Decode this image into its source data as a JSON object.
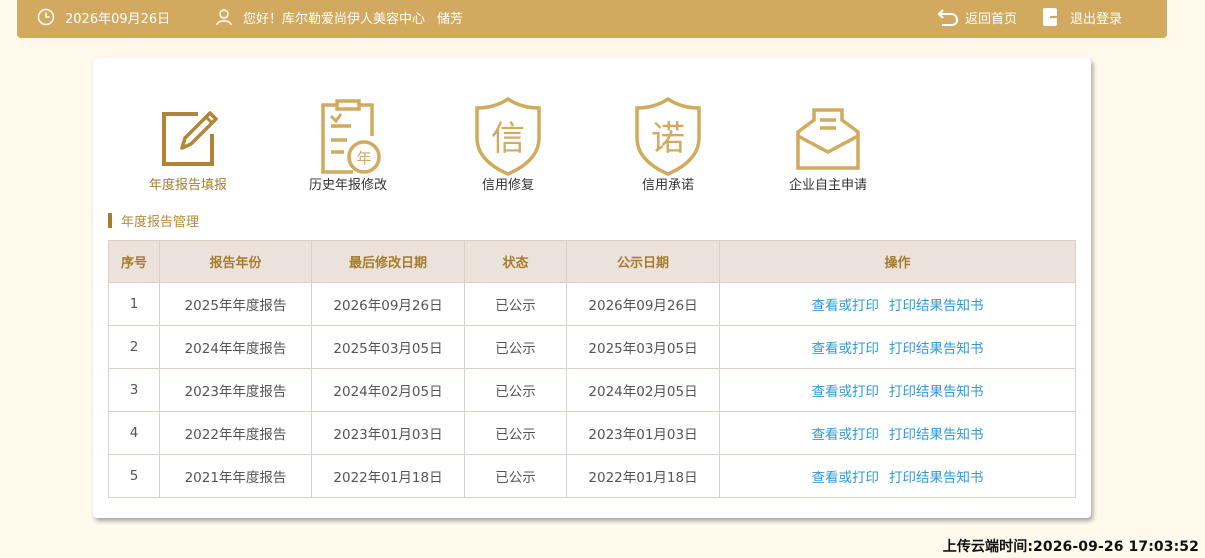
{
  "header": {
    "date": "2026年09月26日",
    "greeting": "您好！库尔勒爱尚伊人美容中心",
    "user": "储芳",
    "home_label": "返回首页",
    "logout_label": "退出登录"
  },
  "tiles": [
    {
      "label": "年度报告填报",
      "icon": "edit-form-icon"
    },
    {
      "label": "历史年报修改",
      "icon": "history-report-icon",
      "icon_text": "年"
    },
    {
      "label": "信用修复",
      "icon": "credit-repair-shield-icon",
      "icon_text": "信"
    },
    {
      "label": "信用承诺",
      "icon": "credit-promise-shield-icon",
      "icon_text": "诺"
    },
    {
      "label": "企业自主申请",
      "icon": "envelope-icon"
    }
  ],
  "section_title": "年度报告管理",
  "table": {
    "headers": [
      "序号",
      "报告年份",
      "最后修改日期",
      "状态",
      "公示日期",
      "操作"
    ],
    "rows": [
      {
        "no": "1",
        "year": "2025年年度报告",
        "modified": "2026年09月26日",
        "status": "已公示",
        "publish": "2026年09月26日"
      },
      {
        "no": "2",
        "year": "2024年年度报告",
        "modified": "2025年03月05日",
        "status": "已公示",
        "publish": "2025年03月05日"
      },
      {
        "no": "3",
        "year": "2023年年度报告",
        "modified": "2024年02月05日",
        "status": "已公示",
        "publish": "2024年02月05日"
      },
      {
        "no": "4",
        "year": "2022年年度报告",
        "modified": "2023年01月03日",
        "status": "已公示",
        "publish": "2023年01月03日"
      },
      {
        "no": "5",
        "year": "2021年年度报告",
        "modified": "2022年01月18日",
        "status": "已公示",
        "publish": "2022年01月18日"
      }
    ],
    "action_view": "查看或打印",
    "action_print": "打印结果告知书"
  },
  "footer": {
    "upload_time": "上传云端时间:2026-09-26 17:03:52"
  },
  "colors": {
    "gold": "#d2aa5f",
    "gold_dark": "#a67c2e",
    "link": "#2d9bd8",
    "page_bg": "#fffaec"
  }
}
